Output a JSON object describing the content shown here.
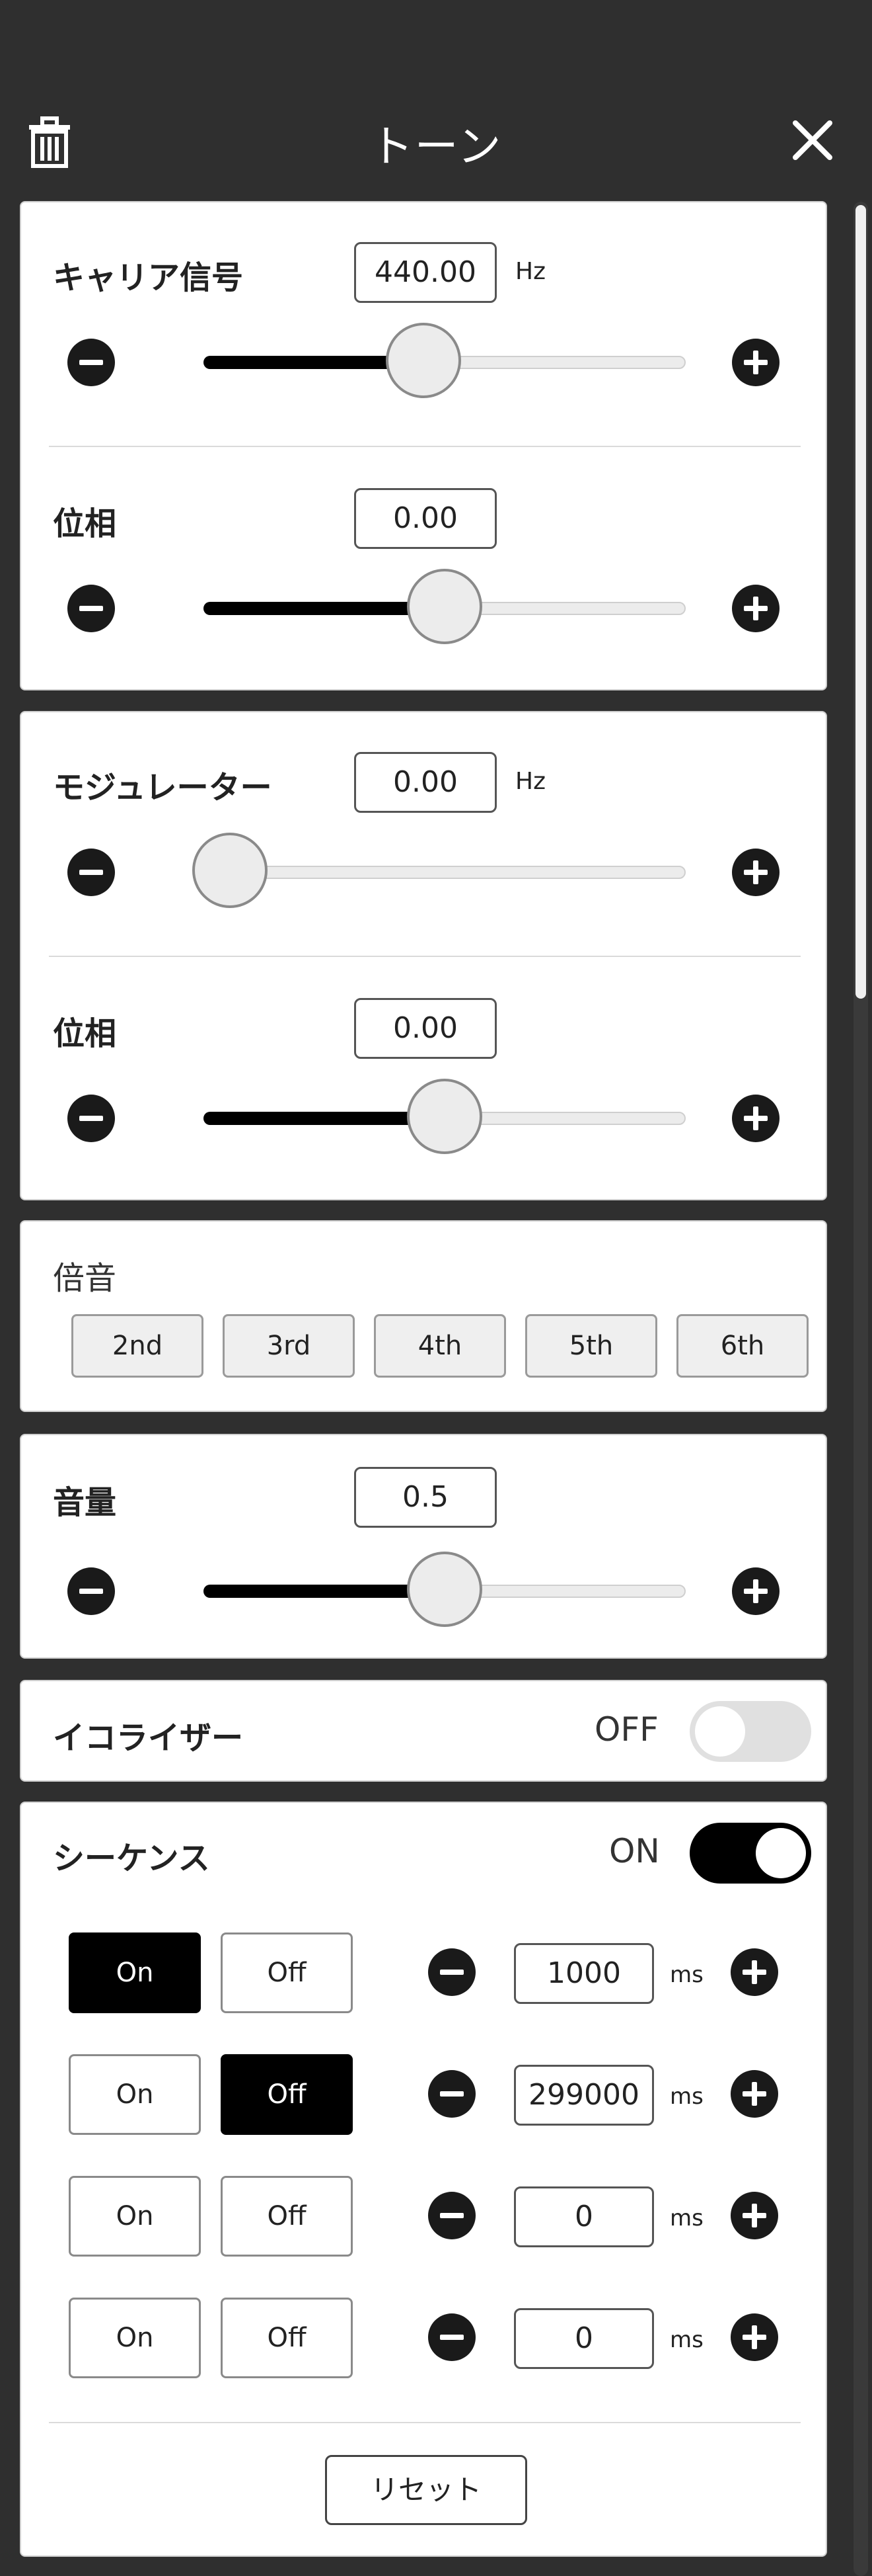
{
  "header": {
    "title": "トーン",
    "trash_icon": "trash-icon",
    "close_icon": "close-icon"
  },
  "carrier": {
    "frequency": {
      "label": "キャリア信号",
      "value": "440.00",
      "unit": "Hz",
      "slider_fraction": 0.45
    },
    "phase": {
      "label": "位相",
      "value": "0.00",
      "slider_fraction": 0.5
    }
  },
  "modulator": {
    "frequency": {
      "label": "モジュレーター",
      "value": "0.00",
      "unit": "Hz",
      "slider_fraction": 0.0
    },
    "phase": {
      "label": "位相",
      "value": "0.00",
      "slider_fraction": 0.5
    }
  },
  "harmonics": {
    "label": "倍音",
    "buttons": [
      "2nd",
      "3rd",
      "4th",
      "5th",
      "6th"
    ]
  },
  "volume": {
    "label": "音量",
    "value": "0.5",
    "slider_fraction": 0.5
  },
  "equalizer": {
    "label": "イコライザー",
    "state": "OFF",
    "enabled": false
  },
  "sequence": {
    "label": "シーケンス",
    "state": "ON",
    "enabled": true,
    "on_label": "On",
    "off_label": "Off",
    "unit": "ms",
    "rows": [
      {
        "value": "1000",
        "active": "on"
      },
      {
        "value": "299000",
        "active": "off"
      },
      {
        "value": "0",
        "active": "none"
      },
      {
        "value": "0",
        "active": "none"
      }
    ],
    "reset_label": "リセット"
  },
  "colors": {
    "background": "#2f2f2f",
    "card": "#ffffff",
    "accent": "#000000",
    "toggle_off": "#e0e0e0"
  }
}
